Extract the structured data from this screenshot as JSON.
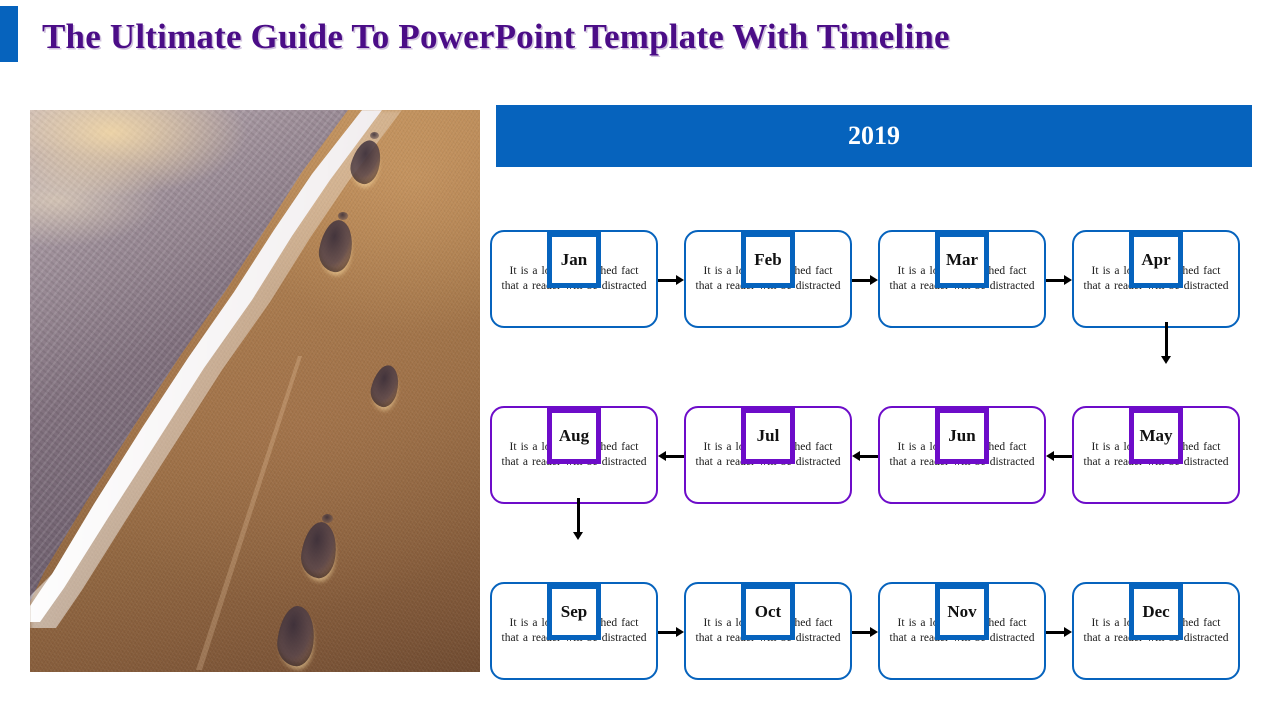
{
  "header": {
    "title": "The Ultimate Guide To PowerPoint Template With Timeline",
    "accent_color": "#0663bd",
    "title_color": "#4b0d87"
  },
  "photo": {
    "alt": "Footprints in wet sand beside ocean foam at sunset"
  },
  "timeline": {
    "year": "2019",
    "year_bar_color": "#0663bd",
    "blue": "#0663bd",
    "purple": "#6d0cc9",
    "body_text": "It is a long established fact that  a reader  will be distracted",
    "rows": [
      {
        "color": "blue",
        "direction": "right",
        "items": [
          {
            "label": "Jan",
            "text": "It is a long established fact that  a reader  will be distracted"
          },
          {
            "label": "Feb",
            "text": "It is a long established fact that  a reader  will be distracted"
          },
          {
            "label": "Mar",
            "text": "It is a long established fact that  a reader  will be distracted"
          },
          {
            "label": "Apr",
            "text": "It is a long established fact that  a reader  will be distracted"
          }
        ]
      },
      {
        "color": "purple",
        "direction": "left",
        "items": [
          {
            "label": "Aug",
            "text": "It is a long established fact that  a reader  will be distracted"
          },
          {
            "label": "Jul",
            "text": "It is a long established fact that  a reader  will be distracted"
          },
          {
            "label": "Jun",
            "text": "It is a long established fact that  a reader  will be distracted"
          },
          {
            "label": "May",
            "text": "It is a long established fact that  a reader  will be distracted"
          }
        ]
      },
      {
        "color": "blue",
        "direction": "right",
        "items": [
          {
            "label": "Sep",
            "text": "It is a long established fact that  a reader  will be distracted"
          },
          {
            "label": "Oct",
            "text": "It is a long established fact that  a reader  will be distracted"
          },
          {
            "label": "Nov",
            "text": "It is a long established fact that  a reader  will be distracted"
          },
          {
            "label": "Dec",
            "text": "It is a long established fact that  a reader  will be distracted"
          }
        ]
      }
    ],
    "connectors": [
      {
        "name": "arrow-apr-may",
        "orientation": "vertical",
        "from": "Apr",
        "to": "May"
      },
      {
        "name": "arrow-aug-sep",
        "orientation": "vertical",
        "from": "Aug",
        "to": "Sep"
      }
    ]
  }
}
